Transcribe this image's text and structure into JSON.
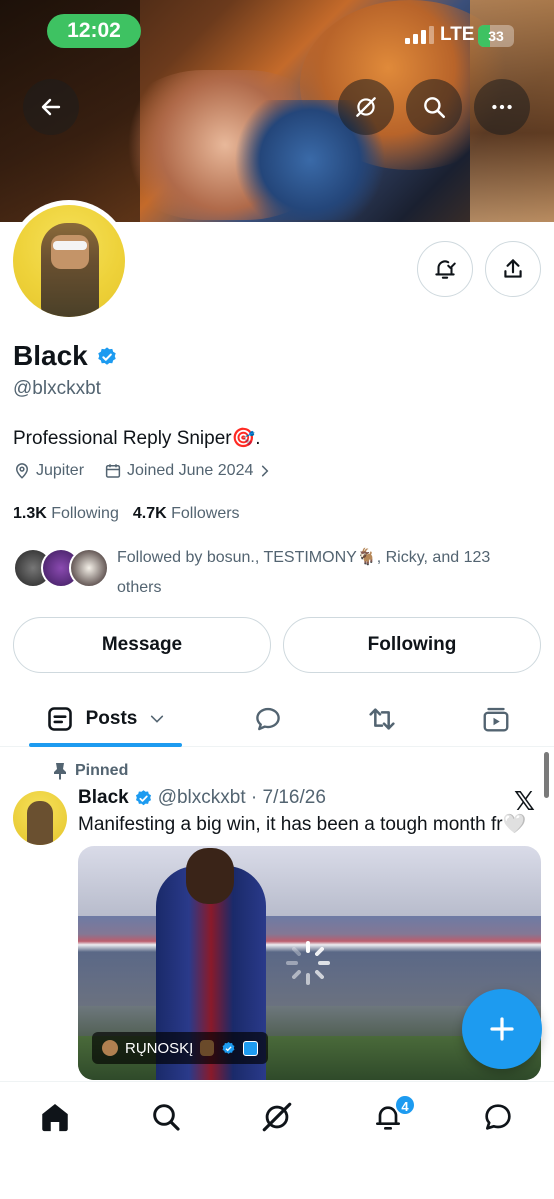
{
  "status_bar": {
    "time": "12:02",
    "network": "LTE",
    "battery": "33",
    "battery_level": 0.33
  },
  "profile": {
    "name": "Black",
    "handle": "@blxckxbt",
    "bio": "Professional Reply Sniper🎯.",
    "location": "Jupiter",
    "joined": "Joined June 2024",
    "following_count": "1.3K",
    "following_label": "Following",
    "followers_count": "4.7K",
    "followers_label": "Followers",
    "followed_by": "Followed by bosun., TESTIMONY🐐, Ricky, and 123 others"
  },
  "buttons": {
    "message": "Message",
    "following": "Following"
  },
  "tabs": {
    "posts": "Posts"
  },
  "post": {
    "pinned_label": "Pinned",
    "author": "Black",
    "handle_date": "@blxckxbt · 7/16/26",
    "text": "Manifesting a big win, it has been a tough month fr🤍",
    "x_logo": "𝕏",
    "media_credit": "RŲNOSKĮ"
  },
  "nav": {
    "notifications_badge": "4"
  },
  "icons": [
    "back-arrow-icon",
    "grok-icon",
    "search-icon",
    "more-icon",
    "bell-plus-icon",
    "share-icon",
    "verified-icon",
    "location-icon",
    "calendar-icon",
    "chevron-right-icon",
    "posts-icon",
    "chevron-down-icon",
    "reply-icon",
    "retweet-icon",
    "media-icon",
    "pin-icon",
    "plus-icon",
    "home-icon",
    "bell-icon",
    "chat-icon"
  ],
  "colors": {
    "accent": "#1d9bf0",
    "time_pill": "#3ec262",
    "text": "#0f1419",
    "secondary": "#536471"
  }
}
